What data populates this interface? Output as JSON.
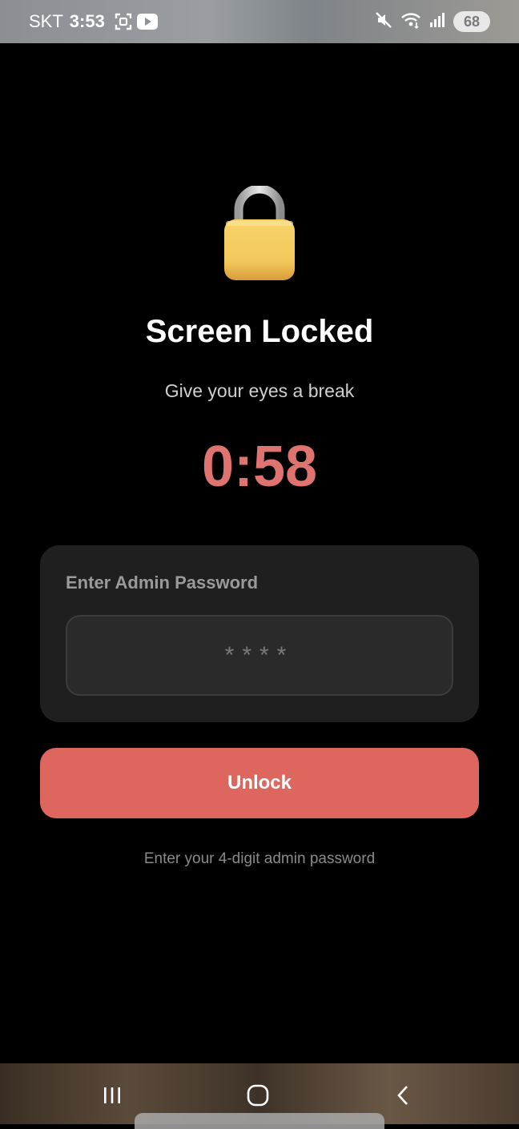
{
  "status_bar": {
    "carrier": "SKT",
    "time": "3:53",
    "battery": "68",
    "icons": [
      "screenshot-icon",
      "youtube-icon",
      "mute-icon",
      "wifi-icon",
      "signal-icon",
      "battery-icon"
    ]
  },
  "lock_screen": {
    "icon": "lock-icon",
    "title": "Screen Locked",
    "subtitle": "Give your eyes a break",
    "countdown": "0:58",
    "password_card": {
      "label": "Enter Admin Password",
      "placeholder": "****",
      "value": ""
    },
    "unlock_label": "Unlock",
    "hint": "Enter your 4-digit admin password"
  },
  "nav_bar": {
    "buttons": [
      "recents-icon",
      "home-icon",
      "back-icon"
    ]
  },
  "colors": {
    "accent": "#dd675f",
    "countdown": "#de7370",
    "card_bg": "#1f1f1f",
    "background": "#000000"
  }
}
